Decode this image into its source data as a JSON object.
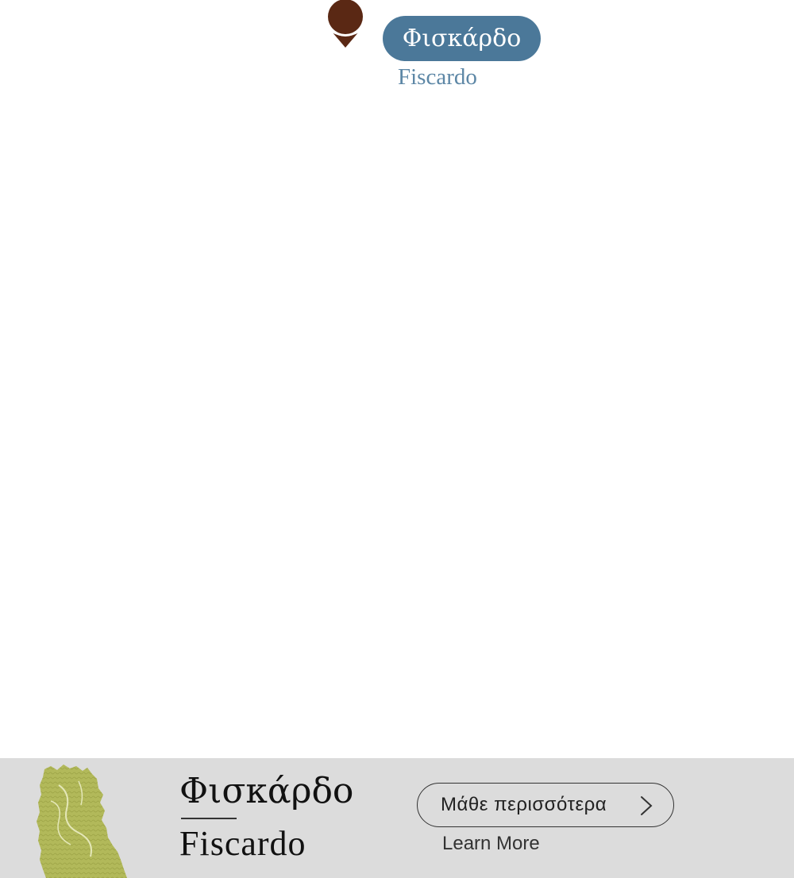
{
  "marker": {
    "icon": "map-pin-icon",
    "pin_color": "#5a2814",
    "label_gr": "Φισκάρδο",
    "label_en": "Fiscardo",
    "pill_color": "#4b7899",
    "sub_color": "#5d87a6"
  },
  "info_bar": {
    "background": "#dcdcdc",
    "thumbnail_icon": "island-map-icon",
    "thumbnail_color": "#b2b95a",
    "title_gr": "Φισκάρδο",
    "title_en": "Fiscardo",
    "learn_more_gr": "Μάθε περισσότερα",
    "learn_more_en": "Learn More",
    "chevron_icon": "chevron-right-icon"
  }
}
